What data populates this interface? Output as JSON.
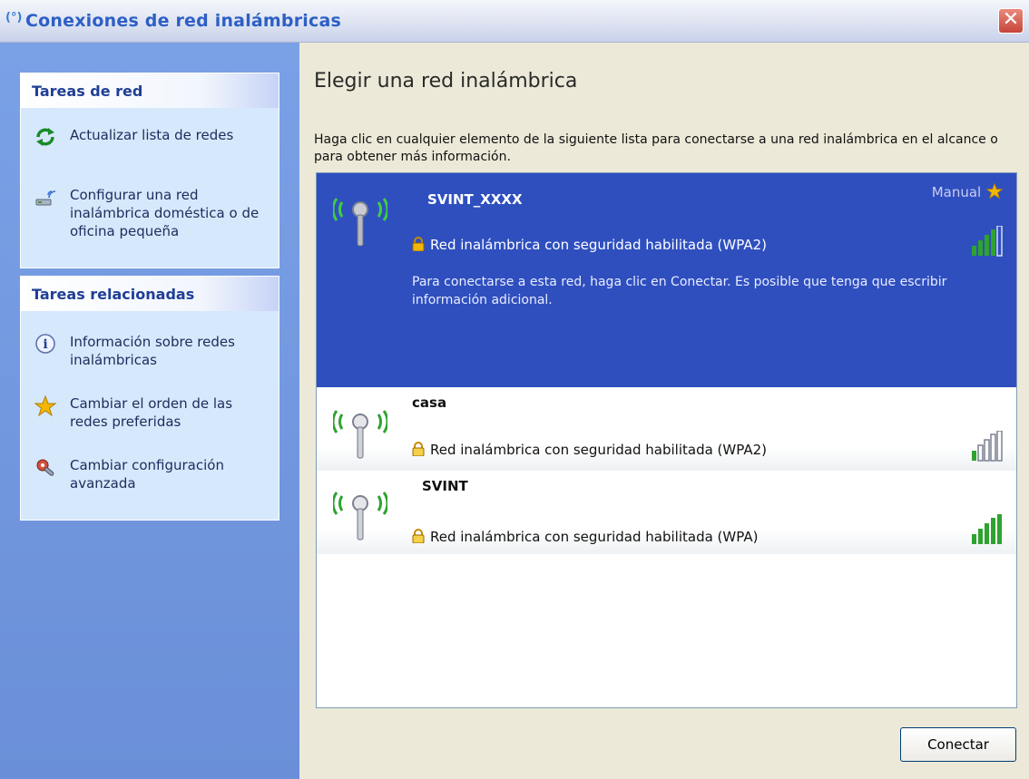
{
  "window": {
    "title": "Conexiones de red inalámbricas",
    "title_icon_glyph": "(°)",
    "close_glyph": "✕"
  },
  "sidebar": {
    "network_tasks": {
      "header": "Tareas de red",
      "items": [
        {
          "label": "Actualizar lista de redes",
          "icon": "refresh-icon"
        },
        {
          "label": "Configurar una red inalámbrica doméstica o de oficina pequeña",
          "icon": "wireless-setup-icon"
        }
      ]
    },
    "related_tasks": {
      "header": "Tareas relacionadas",
      "items": [
        {
          "label": "Información sobre redes inalámbricas",
          "icon": "info-icon"
        },
        {
          "label": "Cambiar el orden de las redes preferidas",
          "icon": "star-icon"
        },
        {
          "label": "Cambiar configuración avanzada",
          "icon": "settings-icon"
        }
      ]
    }
  },
  "main": {
    "heading": "Elegir una red inalámbrica",
    "instructions": "Haga clic en cualquier elemento de la siguiente lista para conectarse a una red inalámbrica en el alcance o para obtener más información.",
    "connect_label": "Conectar",
    "networks": [
      {
        "name": "SVINT_XXXX",
        "security": "Red inalámbrica con seguridad habilitada (WPA2)",
        "detail": "Para conectarse a esta red, haga clic en Conectar. Es posible que tenga que escribir información adicional.",
        "manual_label": "Manual",
        "signal_bars": 4,
        "selected": true
      },
      {
        "name": "casa",
        "security": "Red inalámbrica con seguridad habilitada (WPA2)",
        "signal_bars": 1,
        "selected": false
      },
      {
        "name": "SVINT",
        "security": "Red inalámbrica con seguridad habilitada (WPA)",
        "signal_bars": 5,
        "selected": false
      }
    ]
  },
  "colors": {
    "selection": "#2f4fbf",
    "title_text": "#2d5fc5",
    "signal_green": "#2fa32f",
    "star_gold": "#f2b705"
  }
}
